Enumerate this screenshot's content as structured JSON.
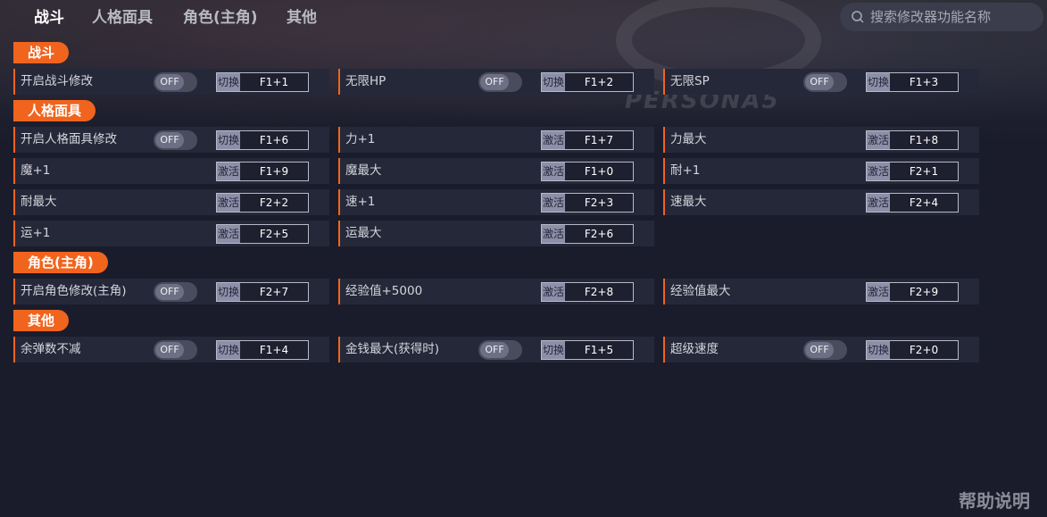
{
  "nav": {
    "tabs": [
      {
        "label": "战斗",
        "active": true
      },
      {
        "label": "人格面具",
        "active": false
      },
      {
        "label": "角色(主角)",
        "active": false
      },
      {
        "label": "其他",
        "active": false
      }
    ]
  },
  "search": {
    "placeholder": "搜索修改器功能名称"
  },
  "banner": {
    "logo_text": "PERSONA5"
  },
  "colors": {
    "accent": "#f0641e",
    "row_bg": "#252838",
    "page_bg": "#1a1c2b"
  },
  "sections": [
    {
      "label": "战斗",
      "rows": [
        {
          "name": "开启战斗修改",
          "toggle": "OFF",
          "kind": "切换",
          "key": "F1+1"
        },
        {
          "name": "无限HP",
          "toggle": "OFF",
          "kind": "切换",
          "key": "F1+2"
        },
        {
          "name": "无限SP",
          "toggle": "OFF",
          "kind": "切换",
          "key": "F1+3"
        }
      ]
    },
    {
      "label": "人格面具",
      "rows": [
        {
          "name": "开启人格面具修改",
          "toggle": "OFF",
          "kind": "切换",
          "key": "F1+6"
        },
        {
          "name": "力+1",
          "kind": "激活",
          "key": "F1+7"
        },
        {
          "name": "力最大",
          "kind": "激活",
          "key": "F1+8"
        },
        {
          "name": "魔+1",
          "kind": "激活",
          "key": "F1+9"
        },
        {
          "name": "魔最大",
          "kind": "激活",
          "key": "F1+0"
        },
        {
          "name": "耐+1",
          "kind": "激活",
          "key": "F2+1"
        },
        {
          "name": "耐最大",
          "kind": "激活",
          "key": "F2+2"
        },
        {
          "name": "速+1",
          "kind": "激活",
          "key": "F2+3"
        },
        {
          "name": "速最大",
          "kind": "激活",
          "key": "F2+4"
        },
        {
          "name": "运+1",
          "kind": "激活",
          "key": "F2+5"
        },
        {
          "name": "运最大",
          "kind": "激活",
          "key": "F2+6"
        }
      ]
    },
    {
      "label": "角色(主角)",
      "rows": [
        {
          "name": "开启角色修改(主角)",
          "toggle": "OFF",
          "kind": "切换",
          "key": "F2+7"
        },
        {
          "name": "经验值+5000",
          "kind": "激活",
          "key": "F2+8"
        },
        {
          "name": "经验值最大",
          "kind": "激活",
          "key": "F2+9"
        }
      ]
    },
    {
      "label": "其他",
      "rows": [
        {
          "name": "余弹数不减",
          "toggle": "OFF",
          "kind": "切换",
          "key": "F1+4"
        },
        {
          "name": "金钱最大(获得时)",
          "toggle": "OFF",
          "kind": "切换",
          "key": "F1+5"
        },
        {
          "name": "超级速度",
          "toggle": "OFF",
          "kind": "切换",
          "key": "F2+0"
        }
      ]
    }
  ],
  "footer": {
    "help_label": "帮助说明"
  }
}
